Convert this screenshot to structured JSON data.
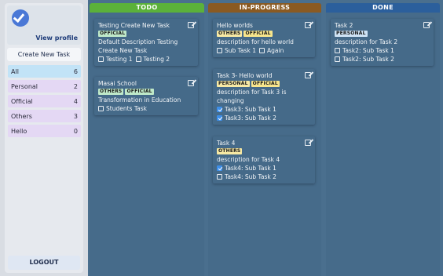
{
  "sidebar": {
    "view_profile": "View profile",
    "create_task": "Create New Task",
    "filters": [
      {
        "label": "All",
        "count": "6"
      },
      {
        "label": "Personal",
        "count": "2"
      },
      {
        "label": "Official",
        "count": "4"
      },
      {
        "label": "Others",
        "count": "3"
      },
      {
        "label": "Hello",
        "count": "0"
      }
    ],
    "logout": "LOGOUT"
  },
  "columns": {
    "todo": "TODO",
    "in_progress": "IN-PROGRESS",
    "done": "DONE"
  },
  "todo_cards": [
    {
      "title": "Testing Create New Task",
      "tags": [
        "OFFICIAL"
      ],
      "description": "Default Description Testing Create New Task",
      "subtasks": [
        {
          "label": "Testing 1",
          "checked": false
        },
        {
          "label": "Testing 2",
          "checked": false
        }
      ]
    },
    {
      "title": "Masai School",
      "tags": [
        "OTHERS",
        "OFFICIAL"
      ],
      "description": "Transformation in Education",
      "subtasks": [
        {
          "label": "Students Task",
          "checked": false
        }
      ]
    }
  ],
  "progress_cards": [
    {
      "title": "Hello worlds",
      "tags": [
        "OTHERS",
        "OFFICIAL"
      ],
      "description": "description for hello world",
      "subtasks": [
        {
          "label": "Sub Task 1",
          "checked": false
        },
        {
          "label": "Again",
          "checked": false
        }
      ]
    },
    {
      "title": "Task 3- Hello world",
      "tags": [
        "PERSONAL",
        "OFFICIAL"
      ],
      "description": "description for Task 3 is changing",
      "subtasks": [
        {
          "label": "Task3: Sub Task 1",
          "checked": true
        },
        {
          "label": "Task3: Sub Task 2",
          "checked": true
        }
      ]
    },
    {
      "title": "Task 4",
      "tags": [
        "OTHERS"
      ],
      "description": "description for Task 4",
      "subtasks": [
        {
          "label": "Task4: Sub Task 1",
          "checked": true
        },
        {
          "label": "Task4: Sub Task 2",
          "checked": false
        }
      ]
    }
  ],
  "done_cards": [
    {
      "title": "Task 2",
      "tags": [
        "PERSONAL"
      ],
      "description": "description for Task 2",
      "subtasks": [
        {
          "label": "Task2: Sub Task 1",
          "checked": false
        },
        {
          "label": "Task2: Sub Task 2",
          "checked": false
        }
      ]
    }
  ],
  "colors": {
    "board": "#4a6f8e",
    "todo_header": "#5bb13a",
    "progress_header": "#8a5a22",
    "done_header": "#2b5f9c",
    "active_filter": "#c2e3f7",
    "filter": "#e4d8f4"
  }
}
